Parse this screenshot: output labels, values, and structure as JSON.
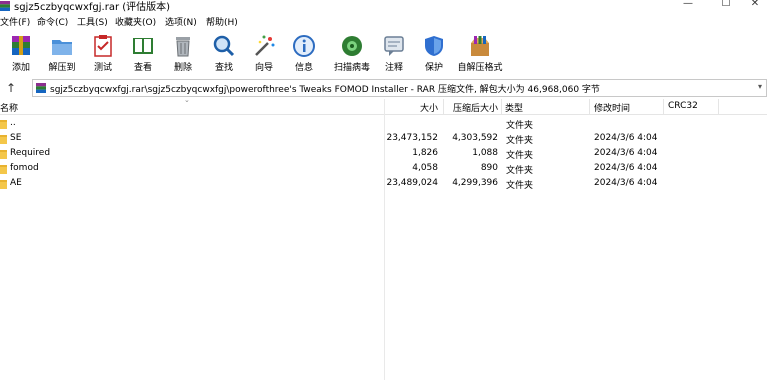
{
  "window": {
    "title": "sgjz5czbyqcwxfgj.rar (评估版本)",
    "minimize": "—",
    "maximize": "☐",
    "close": "✕"
  },
  "menu": [
    "文件(F)",
    "命令(C)",
    "工具(S)",
    "收藏夹(O)",
    "选项(N)",
    "帮助(H)"
  ],
  "toolbar": [
    {
      "label": "添加",
      "icon": "add-archive-icon"
    },
    {
      "label": "解压到",
      "icon": "extract-folder-icon"
    },
    {
      "label": "测试",
      "icon": "test-clipboard-icon"
    },
    {
      "label": "查看",
      "icon": "view-book-icon"
    },
    {
      "label": "删除",
      "icon": "trash-icon"
    },
    {
      "label": "查找",
      "icon": "magnifier-icon"
    },
    {
      "label": "向导",
      "icon": "wizard-wand-icon"
    },
    {
      "label": "信息",
      "icon": "info-icon"
    },
    {
      "label": "扫描病毒",
      "icon": "virus-scan-icon"
    },
    {
      "label": "注释",
      "icon": "comment-icon"
    },
    {
      "label": "保护",
      "icon": "shield-icon"
    },
    {
      "label": "自解压格式",
      "icon": "sfx-box-icon"
    }
  ],
  "address": {
    "up": "↑",
    "path": "sgjz5czbyqcwxfgj.rar\\sgjz5czbyqcwxfgj\\powerofthree's Tweaks FOMOD Installer - RAR 压缩文件, 解包大小为 46,968,060 字节",
    "dropdown": "▾"
  },
  "columns": {
    "name": "名称",
    "size": "大小",
    "packed": "压缩后大小",
    "type": "类型",
    "modified": "修改时间",
    "crc": "CRC32"
  },
  "rows": [
    {
      "name": "..",
      "size": "",
      "packed": "",
      "type": "文件夹",
      "modified": ""
    },
    {
      "name": "SE",
      "size": "23,473,152",
      "packed": "4,303,592",
      "type": "文件夹",
      "modified": "2024/3/6 4:04"
    },
    {
      "name": "Required",
      "size": "1,826",
      "packed": "1,088",
      "type": "文件夹",
      "modified": "2024/3/6 4:04"
    },
    {
      "name": "fomod",
      "size": "4,058",
      "packed": "890",
      "type": "文件夹",
      "modified": "2024/3/6 4:04"
    },
    {
      "name": "AE",
      "size": "23,489,024",
      "packed": "4,299,396",
      "type": "文件夹",
      "modified": "2024/3/6 4:04"
    }
  ],
  "colors": {
    "folder": "#f4c74a",
    "border": "#c8c8c8"
  }
}
